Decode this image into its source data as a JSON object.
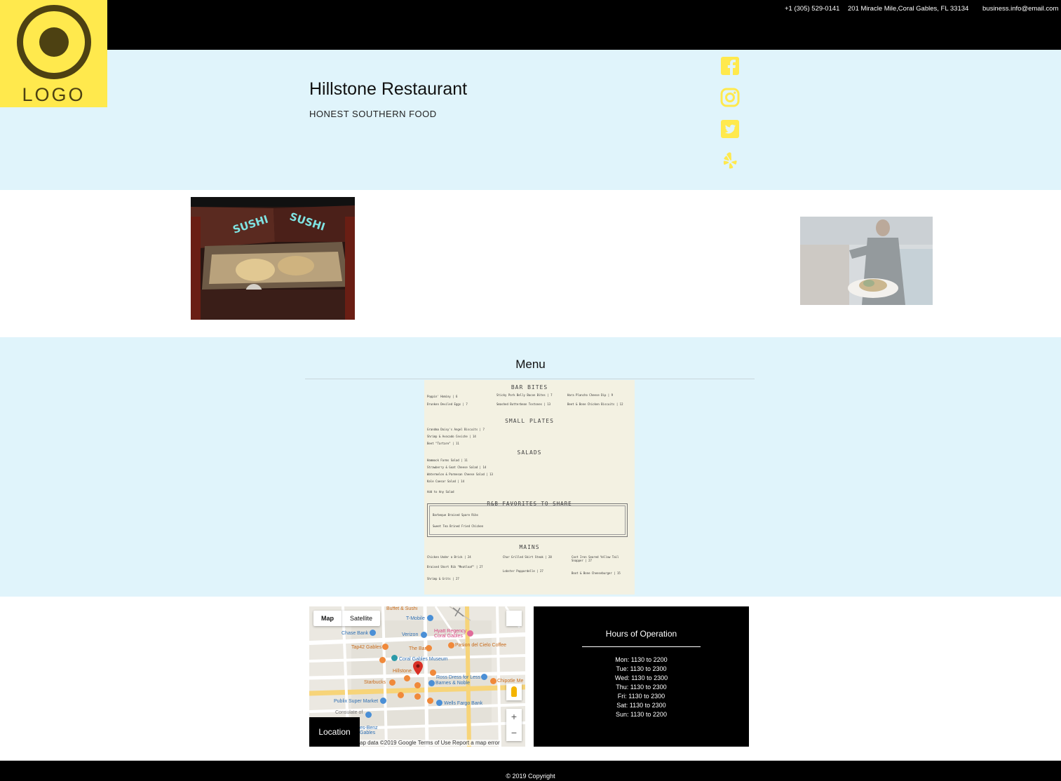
{
  "header": {
    "phone": "+1 (305) 529-0141",
    "address": "201 Miracle Mile,Coral Gables, FL 33134",
    "email": "business.info@email.com"
  },
  "logo": {
    "text": "LOGO"
  },
  "hero": {
    "title": "Hillstone Restaurant",
    "tagline": "HONEST SOUTHERN FOOD",
    "social_icons": [
      "facebook-icon",
      "instagram-icon",
      "twitter-icon",
      "yelp-icon"
    ],
    "icon_color": "#ffe94d"
  },
  "gallery": {
    "photo_text_left": "SUSHI",
    "photo_text_right": "SUSHI"
  },
  "menu": {
    "heading": "Menu",
    "card": {
      "sections": [
        "BAR BITES",
        "SMALL PLATES",
        "SALADS",
        "R&B FAVORITES TO SHARE",
        "MAINS"
      ],
      "bar_bites": [
        "Poppin' Hominy | 6",
        "Sticky Pork Belly Bacon Bites | 7",
        "Hara Plancho Cheese Dip | 9",
        "Drunken Deviled Eggs | 7",
        "Smashed Butterbean Tostones | 13",
        "Beet & Bone Chicken Biscuits | 12"
      ],
      "small_plates": [
        "Grandma Daisy's Angel Biscuits | 7",
        "Shrimp & Avocado Ceviche | 14",
        "Beet \"Tartare\" | 11"
      ],
      "salads": [
        "Hammock Farms Salad | 11",
        "Strawberry & Goat Cheese Salad | 14",
        "Watermelon & Parmesan Cheese Salad | 13",
        "Kale Caesar Salad | 14",
        "Add to Any Salad"
      ],
      "favorites": [
        "Barbeque Braised Spare Ribs",
        "Sweet Tea Brined Fried Chicken"
      ],
      "mains": [
        "Chicken Under a Brick | 24",
        "Char Grilled Skirt Steak | 28",
        "Cast Iron Seared Yellow Tail Snapper | 27",
        "Braised Short Rib \"Meatloaf\" | 27",
        "Lobster Pappardelle | 27",
        "Shrimp & Grits | 27",
        "Boot & Bone Cheeseburger | 15"
      ]
    }
  },
  "map": {
    "tab_map": "Map",
    "tab_satellite": "Satellite",
    "labels": {
      "buffet": "Buffet & Sushi",
      "tmobile": "T-Mobile",
      "chase": "Chase Bank",
      "verizon": "Verizon",
      "hyatt": "Hyatt Regency Coral Gables",
      "tap42": "Tap42 Gables",
      "thebar": "The Bar",
      "pasion": "Pasion del Cielo Coffee",
      "museum": "Coral Gables Museum",
      "hillstone": "Hillstone",
      "ross": "Ross Dress for Less",
      "barnes": "Barnes & Noble",
      "starbucks": "Starbucks",
      "chipotle": "Chipotle Me",
      "publix": "Publix Super Market",
      "wells": "Wells Fargo Bank",
      "consulate": "Consulate of",
      "benz": "es-Benz Gables"
    },
    "attribution": "ap data ©2019 Google   Terms of Use   Report a map error",
    "location_label": "Location",
    "zoom_in": "+",
    "zoom_out": "−"
  },
  "hours": {
    "title": "Hours of Operation",
    "days": [
      "Mon: 1130 to 2200",
      "Tue: 1130 to 2300",
      "Wed: 1130 to 2300",
      "Thu: 1130 to 2300",
      "Fri: 1130 to 2300",
      "Sat: 1130 to 2300",
      "Sun: 1130 to 2200"
    ]
  },
  "footer": {
    "copyright": "© 2019 Copyright"
  }
}
